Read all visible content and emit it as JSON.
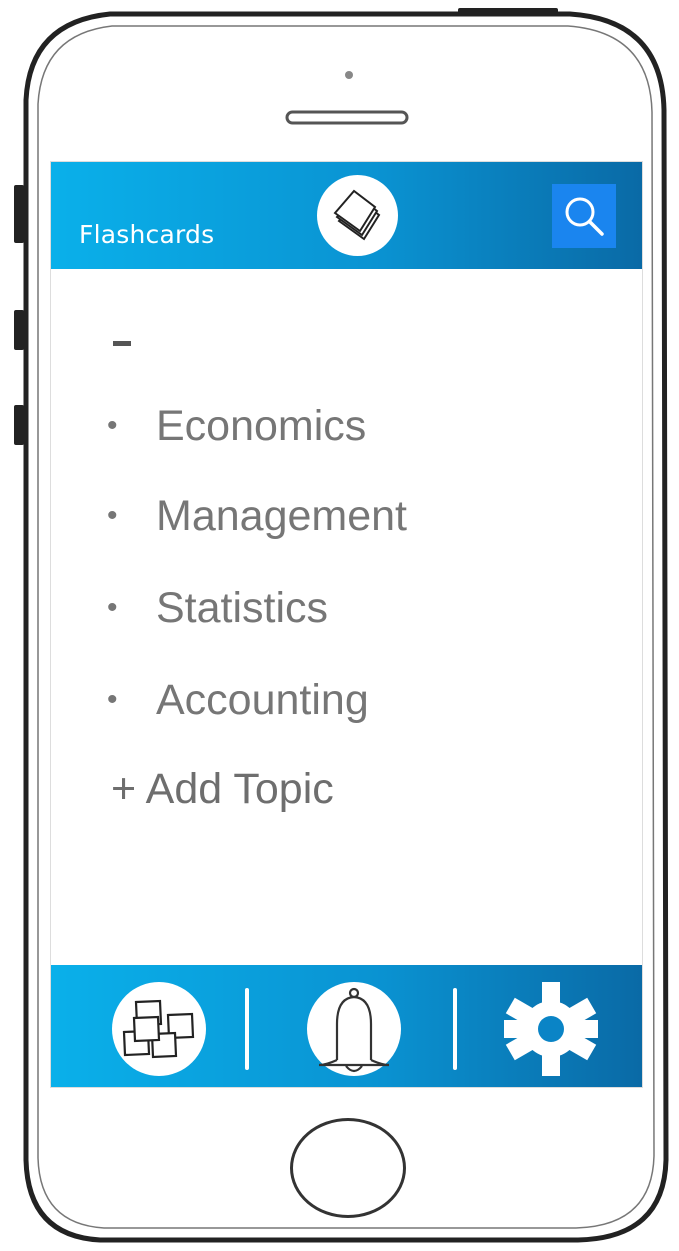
{
  "header": {
    "title": "Flashcards",
    "logo_icon": "flashcards-stack-icon",
    "search_icon": "search-icon"
  },
  "topics": {
    "collapse_marker": "-",
    "items": [
      {
        "bullet": "•",
        "label": "Economics"
      },
      {
        "bullet": "•",
        "label": "Management"
      },
      {
        "bullet": "•",
        "label": "Statistics"
      },
      {
        "bullet": "•",
        "label": "Accounting"
      }
    ],
    "add_label": "+ Add Topic"
  },
  "bottom_nav": {
    "items": [
      {
        "icon": "cards-icon"
      },
      {
        "icon": "bell-icon"
      },
      {
        "icon": "gear-icon"
      }
    ]
  },
  "colors": {
    "bar_start": "#0ab0ea",
    "bar_end": "#0a6aa6",
    "search_button": "#1a85ef",
    "topic_text": "#767676"
  }
}
